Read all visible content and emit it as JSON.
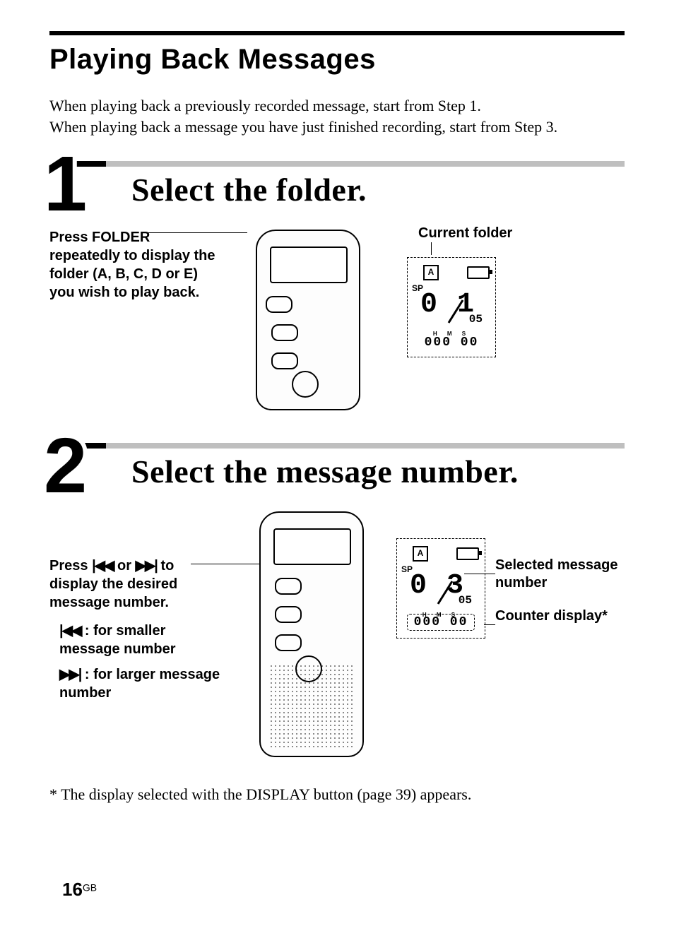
{
  "page_title": "Playing Back Messages",
  "intro": "When playing back a previously recorded message, start from Step 1.\nWhen playing back a message you have just finished recording, start from Step 3.",
  "step1": {
    "number": "1",
    "title": "Select the folder.",
    "instruction": "Press FOLDER repeatedly to display the folder (A, B, C, D or E) you wish to play back.",
    "display_caption": "Current folder",
    "lcd": {
      "folder_letter": "A",
      "mode": "SP",
      "msg_no": "0 1",
      "total": "05",
      "counter": "000 00",
      "counter_units": "H  M  S"
    }
  },
  "step2": {
    "number": "2",
    "title": "Select the message number.",
    "instruction_main": "Press ⏮ or ⏭ to display the desired message number.",
    "sub_prev": "⏮ : for smaller message number",
    "sub_next": "⏭ : for larger message number",
    "right_label_selected": "Selected message number",
    "right_label_counter": "Counter display*",
    "lcd": {
      "folder_letter": "A",
      "mode": "SP",
      "msg_no": "0 3",
      "total": "05",
      "counter": "000 00",
      "counter_units": "H  M  S"
    }
  },
  "footnote": "* The display selected with the DISPLAY button (page 39) appears.",
  "page_number": "16",
  "page_number_suffix": "GB"
}
